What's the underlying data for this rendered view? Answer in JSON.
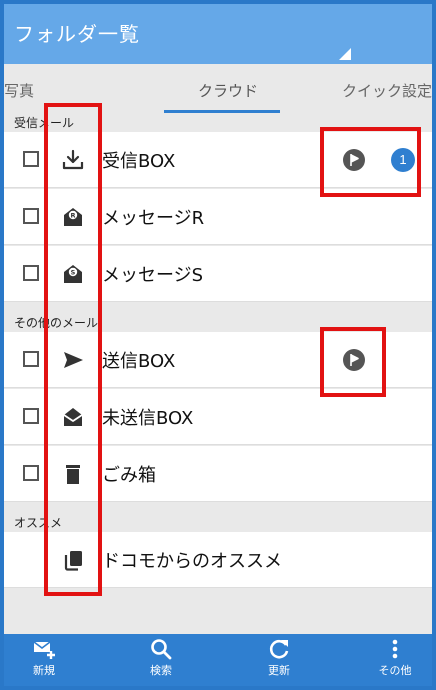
{
  "header": {
    "title": "フォルダ一覧"
  },
  "tabs": [
    {
      "label": "写真"
    },
    {
      "label": "クラウド"
    },
    {
      "label": "クイック設定"
    }
  ],
  "sections": {
    "inbox": "受信メール",
    "other": "その他のメール",
    "recommend": "オススメ"
  },
  "folders": [
    {
      "label": "受信BOX",
      "icon": "inbox-download-icon",
      "unread": "1"
    },
    {
      "label": "メッセージR",
      "icon": "envelope-r-icon"
    },
    {
      "label": "メッセージS",
      "icon": "envelope-s-icon"
    },
    {
      "label": "送信BOX",
      "icon": "send-icon"
    },
    {
      "label": "未送信BOX",
      "icon": "open-envelope-icon"
    },
    {
      "label": "ごみ箱",
      "icon": "trash-icon"
    },
    {
      "label": "ドコモからのオススメ",
      "icon": "stacked-cards-icon"
    }
  ],
  "bottom_nav": [
    {
      "label": "新規",
      "icon": "compose-icon"
    },
    {
      "label": "検索",
      "icon": "search-icon"
    },
    {
      "label": "更新",
      "icon": "refresh-icon"
    },
    {
      "label": "その他",
      "icon": "more-icon"
    }
  ],
  "colors": {
    "header": "#65a8e8",
    "accent": "#2f7fd0",
    "highlight": "#e21212"
  }
}
